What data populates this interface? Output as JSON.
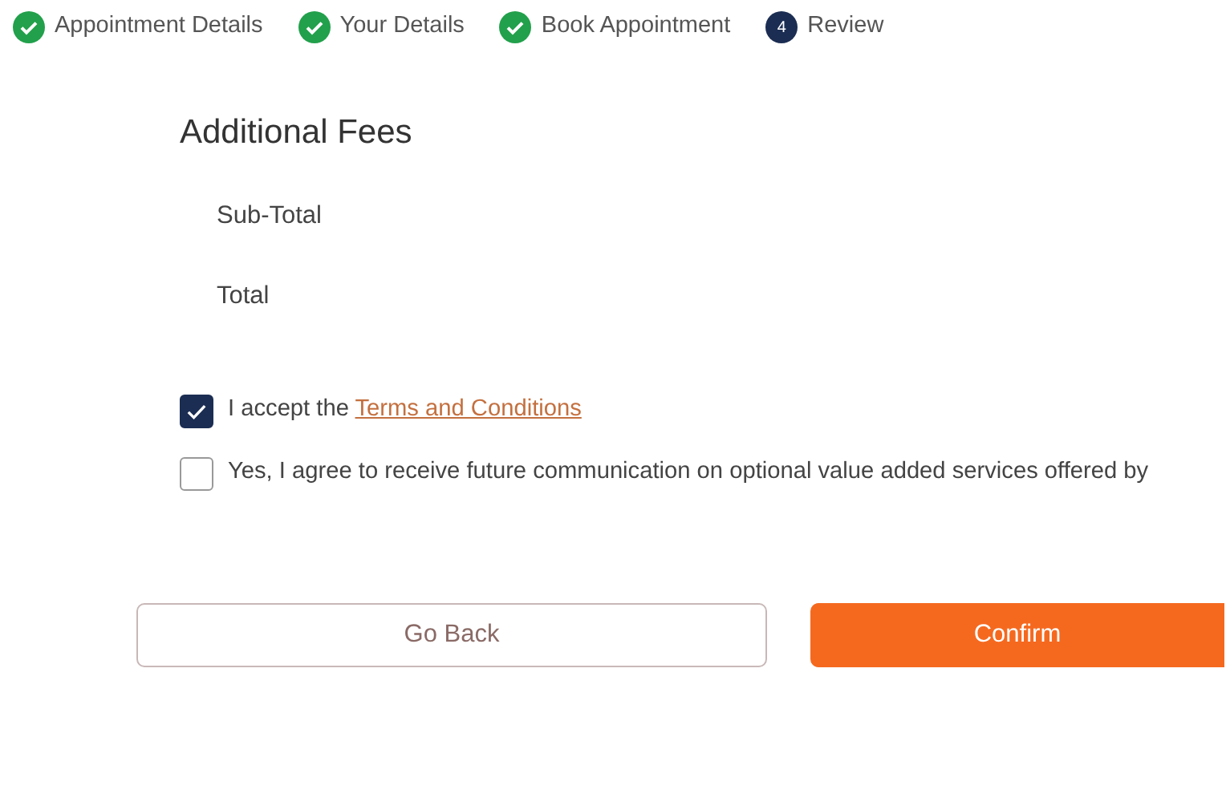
{
  "steps": [
    {
      "label": "Appointment Details",
      "done": true
    },
    {
      "label": "Your Details",
      "done": true
    },
    {
      "label": "Book Appointment",
      "done": true
    },
    {
      "label": "Review",
      "done": false,
      "number": "4"
    }
  ],
  "section_title": "Additional Fees",
  "fee_rows": [
    {
      "label": "Sub-Total"
    },
    {
      "label": "Total"
    }
  ],
  "consents": [
    {
      "text": "I accept the ",
      "link": "Terms and Conditions",
      "checked": true
    },
    {
      "text": "Yes, I agree to receive future communication on optional value added services offered by",
      "checked": false
    }
  ],
  "buttons": [
    {
      "label": "Go Back",
      "kind": "secondary"
    },
    {
      "label": "Confirm",
      "kind": "primary"
    }
  ]
}
